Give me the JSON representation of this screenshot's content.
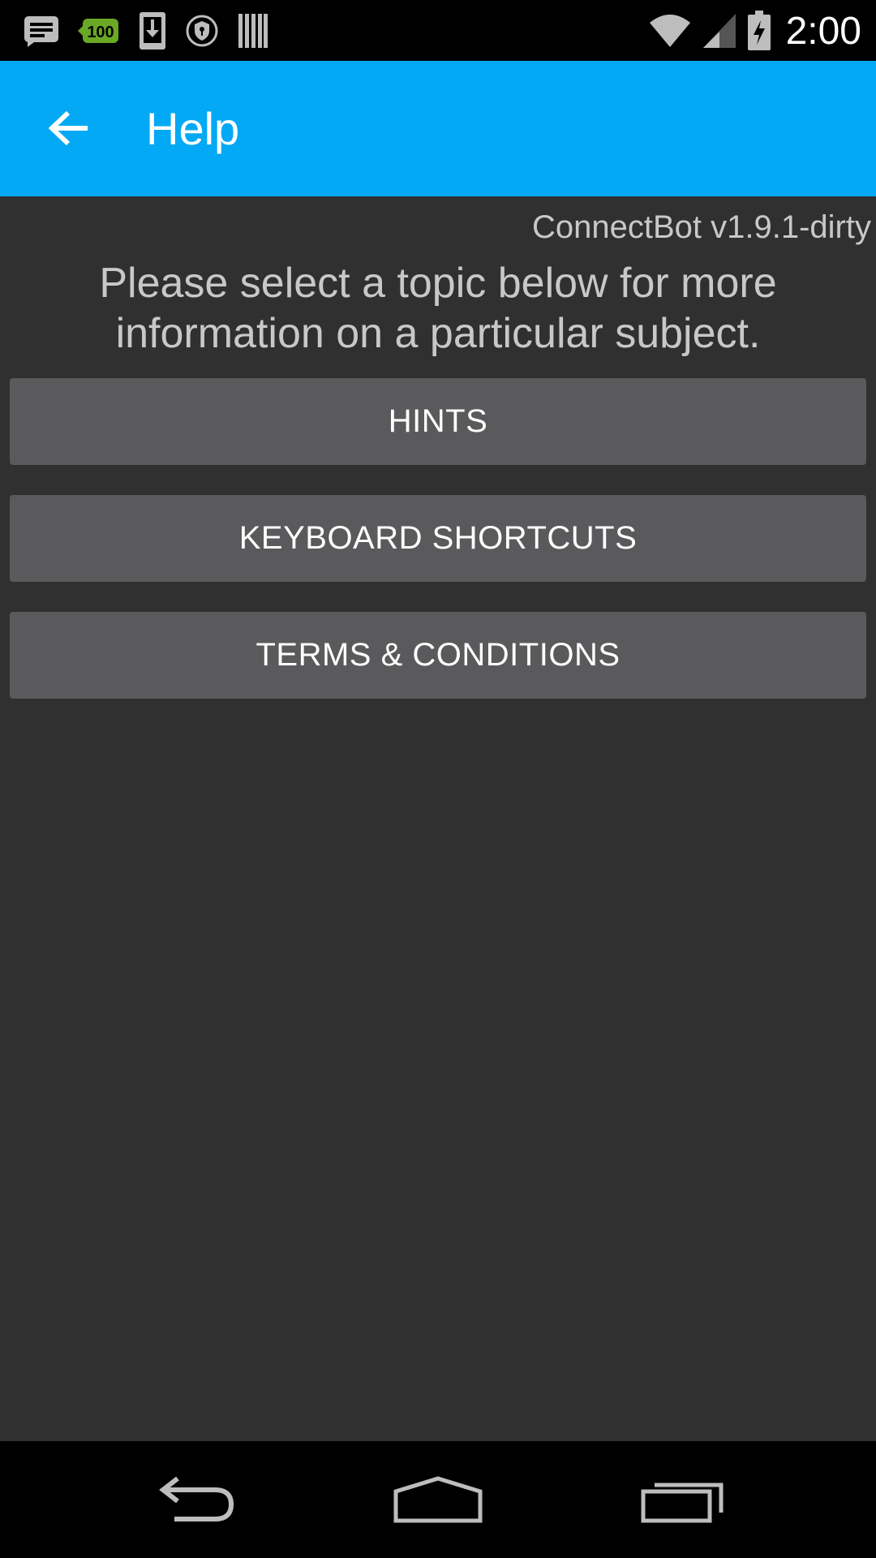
{
  "status_bar": {
    "time": "2:00",
    "battery_badge": "100",
    "icons": [
      "notification-text-icon",
      "battery-100-badge-icon",
      "download-icon",
      "vpn-shield-icon",
      "barcode-icon",
      "wifi-icon",
      "signal-icon",
      "battery-charging-icon"
    ]
  },
  "app_bar": {
    "title": "Help",
    "back_icon": "arrow-back-icon",
    "color": "#03a9f4"
  },
  "content": {
    "version": "ConnectBot v1.9.1-dirty",
    "intro": "Please select a topic below for more information on a particular subject.",
    "buttons": [
      {
        "label": "HINTS"
      },
      {
        "label": "KEYBOARD SHORTCUTS"
      },
      {
        "label": "TERMS & CONDITIONS"
      }
    ]
  },
  "nav_bar": {
    "icons": [
      "nav-back-icon",
      "nav-home-icon",
      "nav-recents-icon"
    ]
  }
}
